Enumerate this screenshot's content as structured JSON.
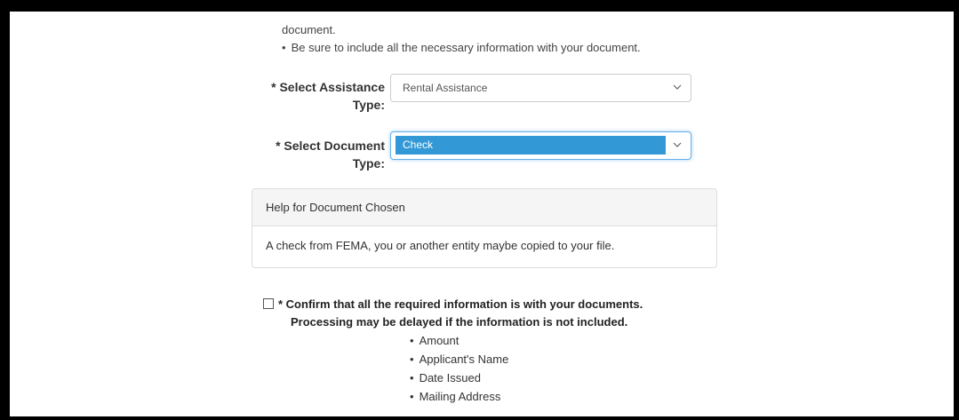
{
  "intro": {
    "tail_text": "document.",
    "bullet": "Be sure to include all the necessary information with your document."
  },
  "bullet_char": "•",
  "assistance": {
    "label_line1": "* Select Assistance",
    "label_line2": "Type:",
    "value": "Rental Assistance"
  },
  "document_type": {
    "label_line1": "* Select Document",
    "label_line2": "Type:",
    "value": "Check"
  },
  "help_panel": {
    "heading": "Help for Document Chosen",
    "body": "A check from FEMA, you or another entity maybe copied to your file."
  },
  "confirm": {
    "line1": "* Confirm that all the required information is with your documents.",
    "line2": "Processing may be delayed if the information is not included.",
    "checked": false
  },
  "required_items": [
    "Amount",
    "Applicant's Name",
    "Date Issued",
    "Mailing Address"
  ],
  "colors": {
    "highlight": "#3399d6",
    "focus_border": "#66afe9"
  },
  "icons": {
    "select_arrow": "chevron-down-icon",
    "checkbox": "checkbox-icon"
  }
}
